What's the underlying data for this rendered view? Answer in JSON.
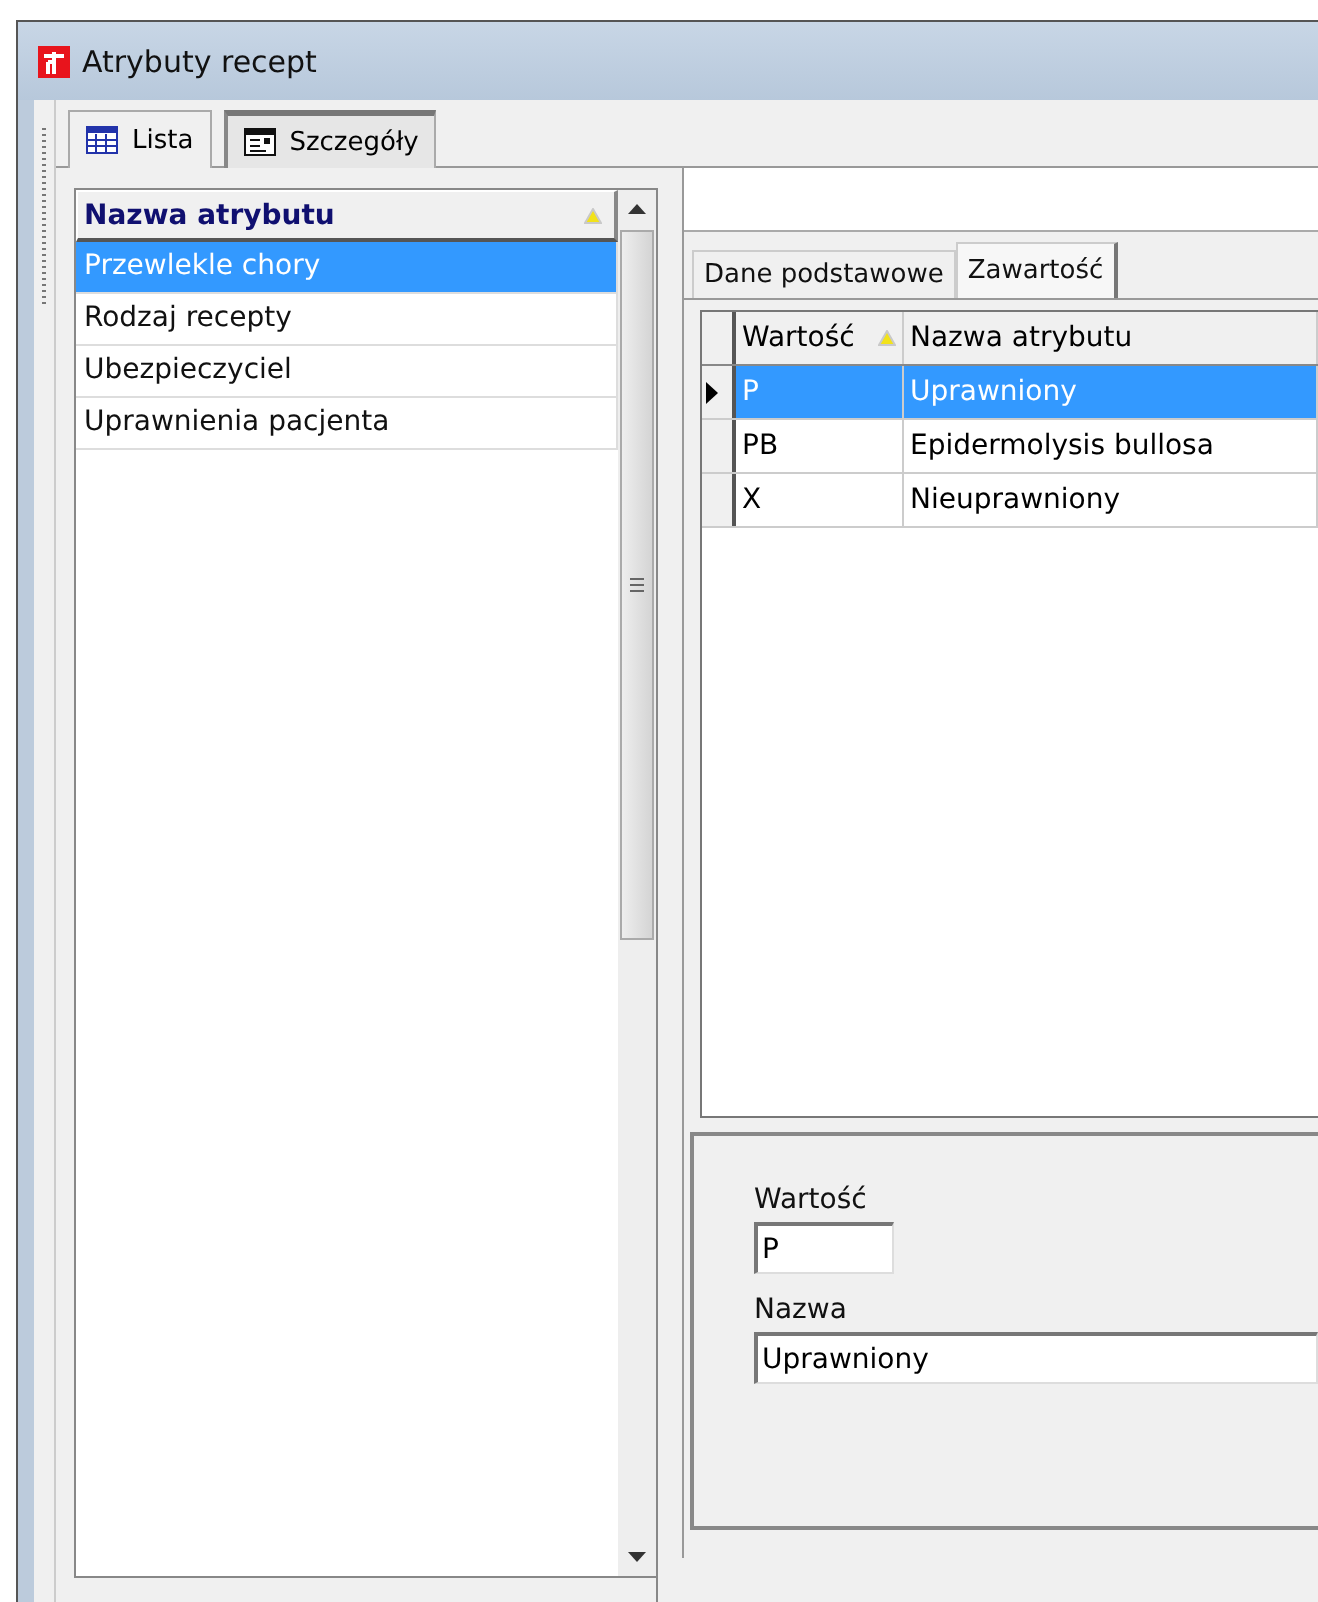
{
  "window": {
    "title": "Atrybuty recept"
  },
  "view_tabs": [
    {
      "label": "Lista",
      "kind": "grid",
      "selected": false
    },
    {
      "label": "Szczegóły",
      "kind": "form",
      "selected": true
    }
  ],
  "attribute_list": {
    "column": "Nazwa atrybutu",
    "rows": [
      {
        "label": "Przewlekle chory",
        "selected": true
      },
      {
        "label": "Rodzaj recepty",
        "selected": false
      },
      {
        "label": "Ubezpieczyciel",
        "selected": false
      },
      {
        "label": "Uprawnienia pacjenta",
        "selected": false
      }
    ]
  },
  "detail_tabs": [
    {
      "label": "Dane podstawowe",
      "selected": false
    },
    {
      "label": "Zawartość",
      "selected": true
    }
  ],
  "values_grid": {
    "columns": [
      "Wartość",
      "Nazwa atrybutu"
    ],
    "rows": [
      {
        "cells": [
          "P",
          "Uprawniony"
        ],
        "selected": true
      },
      {
        "cells": [
          "PB",
          "Epidermolysis bullosa"
        ],
        "selected": false
      },
      {
        "cells": [
          "X",
          "Nieuprawniony"
        ],
        "selected": false
      }
    ]
  },
  "form": {
    "fields": [
      {
        "label": "Wartość",
        "value": "P",
        "kind": "short"
      },
      {
        "label": "Nazwa",
        "value": "Uprawniony",
        "kind": "wide"
      }
    ]
  }
}
